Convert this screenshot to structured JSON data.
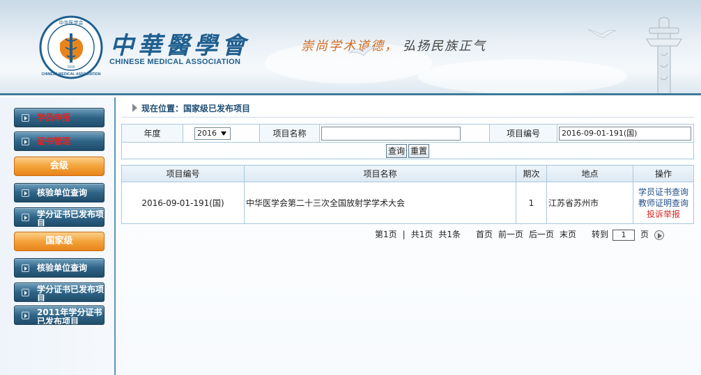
{
  "header": {
    "logo_cn": "中華醫學會",
    "logo_en": "CHINESE MEDICAL ASSOCIATION",
    "seal_text_top": "中华医学会",
    "seal_text_bottom": "CHINESE MEDICAL ASSOCIATION",
    "seal_year": "1915",
    "slogan_1": "崇尚学术道德，",
    "slogan_2": "弘扬民族正气",
    "brand_color": "#1f5f8f"
  },
  "sidebar": {
    "items": [
      {
        "label": "学员申报",
        "style": "red"
      },
      {
        "label": "证书管理",
        "style": "red"
      },
      {
        "label": "会级",
        "style": "category"
      },
      {
        "label": "核验单位查询",
        "style": "white"
      },
      {
        "label": "学分证书已发布项目",
        "style": "white"
      },
      {
        "label": "国家级",
        "style": "category"
      },
      {
        "label": "核验单位查询",
        "style": "white"
      },
      {
        "label": "学分证书已发布项目",
        "style": "white"
      },
      {
        "label": "2011年学分证书已发布项目",
        "style": "white"
      }
    ]
  },
  "breadcrumb": {
    "prefix": "现在位置：",
    "current": "国家级已发布项目"
  },
  "search": {
    "year_label": "年度",
    "year_value": "2016",
    "name_label": "项目名称",
    "name_value": "",
    "code_label": "项目编号",
    "code_value": "2016-09-01-191(国)",
    "query_button": "查询",
    "reset_button": "重置"
  },
  "results": {
    "headers": [
      "项目编号",
      "项目名称",
      "期次",
      "地点",
      "操作"
    ],
    "rows": [
      {
        "code": "2016-09-01-191(国)",
        "name": "中华医学会第二十三次全国放射学学术大会",
        "issue": "1",
        "location": "江苏省苏州市",
        "actions": [
          "学员证书查询",
          "教师证明查询",
          "投诉举报"
        ]
      }
    ]
  },
  "pager": {
    "current": "第1页",
    "sep": "|",
    "total_pages": "共1页",
    "total_items": "共1条",
    "first": "首页",
    "prev": "前一页",
    "next": "后一页",
    "last": "末页",
    "goto": "转到",
    "page_value": "1",
    "page_suffix": "页"
  }
}
